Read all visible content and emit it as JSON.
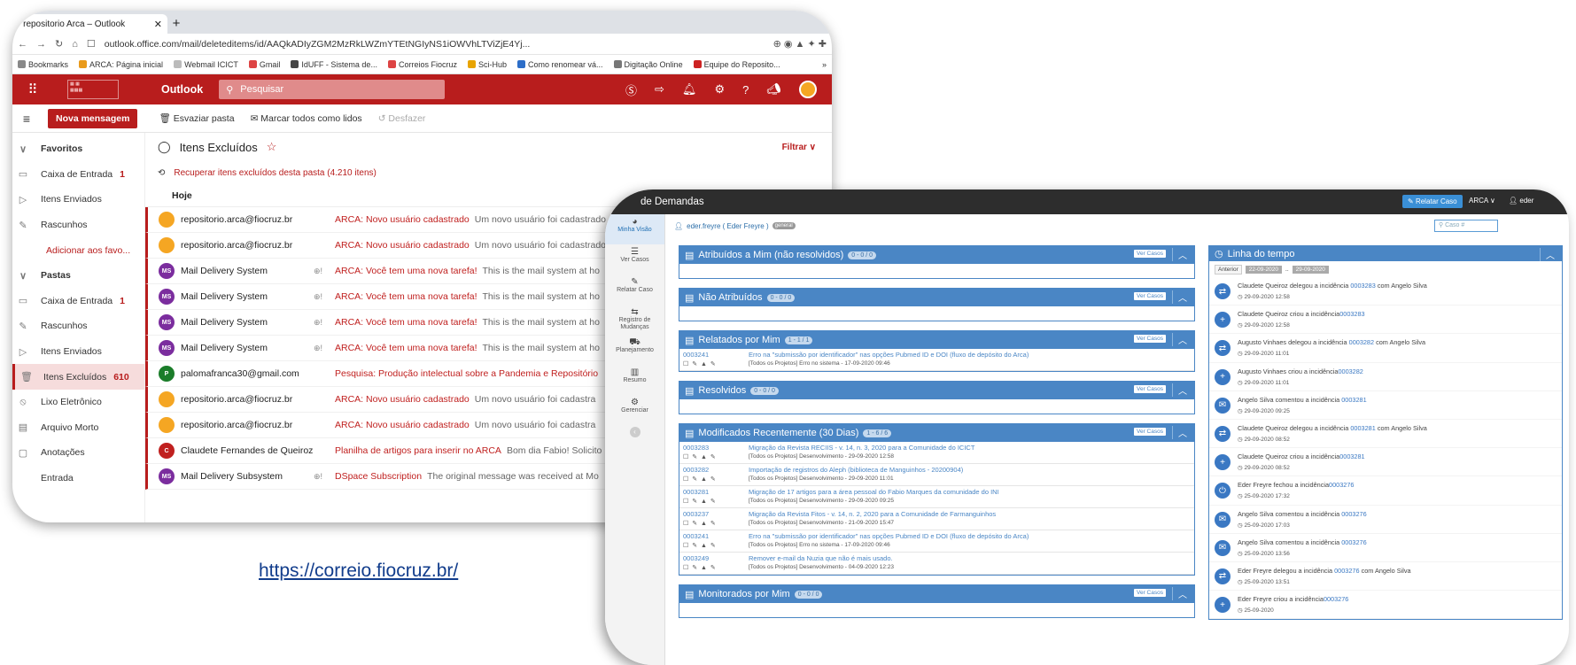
{
  "outlook": {
    "tab_title": "- repositorio Arca – Outlook",
    "tab_close": "✕",
    "new_tab": "+",
    "url": "outlook.office.com/mail/deleteditems/id/AAQkADIyZGM2MzRkLWZmYTEtNGIyNS1iOWVhLTViZjE4Yj...",
    "bookmarks": [
      "Bookmarks",
      "ARCA: Página inicial",
      "Webmail ICICT",
      "Gmail",
      "IdUFF - Sistema de...",
      "Correios Fiocruz",
      "Sci-Hub",
      "Como renomear vá...",
      "Digitação Online",
      "Equipe do Reposito..."
    ],
    "bookmark_colors": [
      "#888",
      "#e99a1b",
      "#bbb",
      "#d44",
      "#444",
      "#d44",
      "#e8a400",
      "#2d6ec8",
      "#777",
      "#c22"
    ],
    "more": "»",
    "brand": "Outlook",
    "search_placeholder": "Pesquisar",
    "new_message": "Nova mensagem",
    "cmd_empty": "Esvaziar pasta",
    "cmd_mark_read": "Marcar todos como lidos",
    "cmd_undo": "Desfazer",
    "sidebar": [
      {
        "label": "Favoritos",
        "icon": "∨",
        "type": "hd"
      },
      {
        "label": "Caixa de Entrada",
        "icon": "▭",
        "count": "1"
      },
      {
        "label": "Itens Enviados",
        "icon": "▷"
      },
      {
        "label": "Rascunhos",
        "icon": "✎"
      },
      {
        "label": "Adicionar aos favo...",
        "type": "link"
      },
      {
        "label": "Pastas",
        "icon": "∨",
        "type": "hd"
      },
      {
        "label": "Caixa de Entrada",
        "icon": "▭",
        "count": "1"
      },
      {
        "label": "Rascunhos",
        "icon": "✎"
      },
      {
        "label": "Itens Enviados",
        "icon": "▷"
      },
      {
        "label": "Itens Excluídos",
        "icon": "🗑",
        "count": "610",
        "type": "sel"
      },
      {
        "label": "Lixo Eletrônico",
        "icon": "⦸"
      },
      {
        "label": "Arquivo Morto",
        "icon": "▤"
      },
      {
        "label": "Anotações",
        "icon": "▢"
      },
      {
        "label": "Entrada",
        "icon": ""
      }
    ],
    "folder_title": "Itens Excluídos",
    "filter": "Filtrar ∨",
    "recover": "Recuperar itens excluídos desta pasta (4.210 itens)",
    "group": "Hoje",
    "messages": [
      {
        "initials": "",
        "color": "#f5a623",
        "from": "repositorio.arca@fiocruz.br",
        "att": "",
        "subject": "ARCA: Novo usuário cadastrado",
        "preview": "Um novo usuário foi cadastrado"
      },
      {
        "initials": "",
        "color": "#f5a623",
        "from": "repositorio.arca@fiocruz.br",
        "att": "",
        "subject": "ARCA: Novo usuário cadastrado",
        "preview": "Um novo usuário foi cadastrado"
      },
      {
        "initials": "MS",
        "color": "#7b2d9e",
        "from": "Mail Delivery System",
        "att": "⊕!",
        "subject": "ARCA: Você tem uma nova tarefa!",
        "preview": "This is the mail system at ho"
      },
      {
        "initials": "MS",
        "color": "#7b2d9e",
        "from": "Mail Delivery System",
        "att": "⊕!",
        "subject": "ARCA: Você tem uma nova tarefa!",
        "preview": "This is the mail system at ho"
      },
      {
        "initials": "MS",
        "color": "#7b2d9e",
        "from": "Mail Delivery System",
        "att": "⊕!",
        "subject": "ARCA: Você tem uma nova tarefa!",
        "preview": "This is the mail system at ho"
      },
      {
        "initials": "MS",
        "color": "#7b2d9e",
        "from": "Mail Delivery System",
        "att": "⊕!",
        "subject": "ARCA: Você tem uma nova tarefa!",
        "preview": "This is the mail system at ho"
      },
      {
        "initials": "P",
        "color": "#1b7d2a",
        "from": "palomafranca30@gmail.com",
        "att": "",
        "subject": "Pesquisa: Produção intelectual sobre a Pandemia e Repositório",
        "preview": ""
      },
      {
        "initials": "",
        "color": "#f5a623",
        "from": "repositorio.arca@fiocruz.br",
        "att": "",
        "subject": "ARCA: Novo usuário cadastrado",
        "preview": "Um novo usuário foi cadastra"
      },
      {
        "initials": "",
        "color": "#f5a623",
        "from": "repositorio.arca@fiocruz.br",
        "att": "",
        "subject": "ARCA: Novo usuário cadastrado",
        "preview": "Um novo usuário foi cadastra"
      },
      {
        "initials": "C",
        "color": "#c0201f",
        "from": "Claudete Fernandes de Queiroz",
        "att": "",
        "subject": "Planilha de artigos para inserir no ARCA",
        "preview": "Bom dia Fabio! Solicito"
      },
      {
        "initials": "MS",
        "color": "#7b2d9e",
        "from": "Mail Delivery Subsystem",
        "att": "⊕!",
        "subject": "DSpace Subscription",
        "preview": "The original message was received at Mo"
      }
    ]
  },
  "caption_link": "https://correio.fiocruz.br/",
  "helpdesk": {
    "title": "de Demandas",
    "report_btn": "Relatar Caso",
    "selector": "ARCA ∨",
    "user_top": "eder",
    "user_line": "eder.freyre ( Eder Freyre )",
    "user_badge": "general",
    "case_search": "Caso #",
    "nav": [
      {
        "label": "Minha Visão",
        "glyph": "◕"
      },
      {
        "label": "Ver Casos",
        "glyph": "☰"
      },
      {
        "label": "Relatar Caso",
        "glyph": "✎"
      },
      {
        "label": "Registro de Mudanças",
        "glyph": "⇆"
      },
      {
        "label": "Planejamento",
        "glyph": "⛟"
      },
      {
        "label": "Resumo",
        "glyph": "▥"
      },
      {
        "label": "Gerenciar",
        "glyph": "⚙"
      }
    ],
    "ver_casos": "Ver Casos",
    "panels": [
      {
        "title": "Atribuídos a Mim (não resolvidos)",
        "count": "0 - 0 / 0",
        "cases": []
      },
      {
        "title": "Não Atribuídos",
        "count": "0 - 0 / 0",
        "cases": []
      },
      {
        "title": "Relatados por Mim",
        "count": "1 - 1 / 1",
        "cases": [
          {
            "id": "0003241",
            "title": "Erro na \"submissão por identificador\" nas opções Pubmed ID e DOI (fluxo de depósito do Arca)",
            "meta": "[Todos os Projetos] Erro no sistema - 17-09-2020 09:46"
          }
        ]
      },
      {
        "title": "Resolvidos",
        "count": "0 - 0 / 0",
        "cases": []
      },
      {
        "title": "Modificados Recentemente (30 Dias)",
        "count": "1 - 6 / 6",
        "cases": [
          {
            "id": "0003283",
            "title": "Migração da Revista RECIIS - v. 14, n. 3, 2020 para a Comunidade do ICICT",
            "meta": "[Todos os Projetos] Desenvolvimento - 29-09-2020 12:58"
          },
          {
            "id": "0003282",
            "title": "Importação de registros do Aleph (biblioteca de Manguinhos - 20200904)",
            "meta": "[Todos os Projetos] Desenvolvimento - 29-09-2020 11:01"
          },
          {
            "id": "0003281",
            "title": "Migração de 17 artigos para a área pessoal do Fabio Marques da comunidade do INI",
            "meta": "[Todos os Projetos] Desenvolvimento - 29-09-2020 09:25"
          },
          {
            "id": "0003237",
            "title": "Migração da Revista Fitos - v. 14, n. 2, 2020 para a Comunidade de Farmanguinhos",
            "meta": "[Todos os Projetos] Desenvolvimento - 21-09-2020 15:47"
          },
          {
            "id": "0003241",
            "title": "Erro na \"submissão por identificador\" nas opções Pubmed ID e DOI (fluxo de depósito do Arca)",
            "meta": "[Todos os Projetos] Erro no sistema - 17-09-2020 09:46"
          },
          {
            "id": "0003249",
            "title": "Remover e-mail da Nuzia que não é mais usado.",
            "meta": "[Todos os Projetos] Desenvolvimento - 04-09-2020 12:23"
          }
        ]
      },
      {
        "title": "Monitorados por Mim",
        "count": "0 - 0 / 0",
        "cases": []
      }
    ],
    "timeline_title": "Linha do tempo",
    "tl_prev": "Anterior",
    "tl_from": "22-09-2020",
    "tl_to": "29-09-2020",
    "events": [
      {
        "icon": "⇄",
        "pre": "Claudete Queiroz delegou a incidência ",
        "num": "0003283",
        "post": " com Angelo Silva",
        "date": "29-09-2020 12:58"
      },
      {
        "icon": "+",
        "pre": "Claudete Queiroz criou a incidência",
        "num": "0003283",
        "post": "",
        "date": "29-09-2020 12:58"
      },
      {
        "icon": "⇄",
        "pre": "Augusto Vinhaes delegou a incidência ",
        "num": "0003282",
        "post": " com Angelo Silva",
        "date": "29-09-2020 11:01"
      },
      {
        "icon": "+",
        "pre": "Augusto Vinhaes criou a incidência",
        "num": "0003282",
        "post": "",
        "date": "29-09-2020 11:01"
      },
      {
        "icon": "✉",
        "pre": "Angelo Silva comentou a incidência ",
        "num": "0003281",
        "post": "",
        "date": "29-09-2020 09:25"
      },
      {
        "icon": "⇄",
        "pre": "Claudete Queiroz delegou a incidência ",
        "num": "0003281",
        "post": " com Angelo Silva",
        "date": "29-09-2020 08:52"
      },
      {
        "icon": "+",
        "pre": "Claudete Queiroz criou a incidência",
        "num": "0003281",
        "post": "",
        "date": "29-09-2020 08:52"
      },
      {
        "icon": "⏻",
        "pre": "Eder Freyre fechou a incidência",
        "num": "0003276",
        "post": "",
        "date": "25-09-2020 17:32"
      },
      {
        "icon": "✉",
        "pre": "Angelo Silva comentou a incidência ",
        "num": "0003276",
        "post": "",
        "date": "25-09-2020 17:03"
      },
      {
        "icon": "✉",
        "pre": "Angelo Silva comentou a incidência ",
        "num": "0003276",
        "post": "",
        "date": "25-09-2020 13:56"
      },
      {
        "icon": "⇄",
        "pre": "Eder Freyre delegou a incidência ",
        "num": "0003276",
        "post": " com Angelo Silva",
        "date": "25-09-2020 13:51"
      },
      {
        "icon": "+",
        "pre": "Eder Freyre criou a incidência",
        "num": "0003276",
        "post": "",
        "date": "25-09-2020"
      }
    ]
  }
}
